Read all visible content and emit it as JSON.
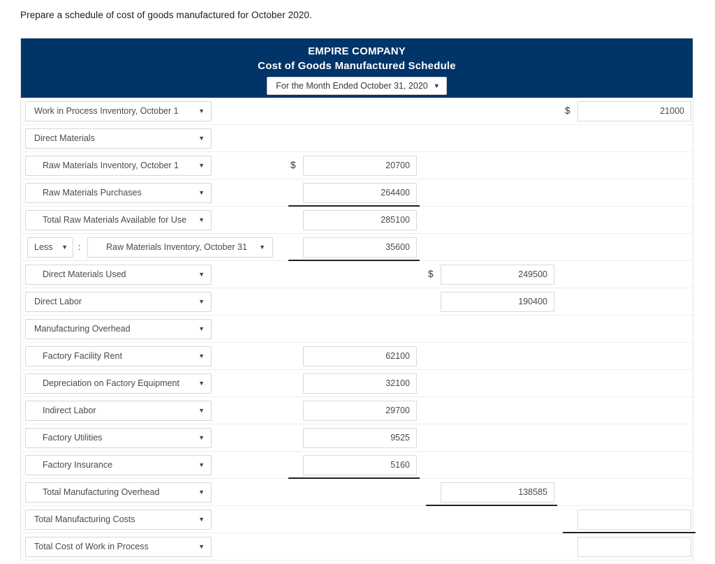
{
  "prompt": "Prepare a schedule of cost of goods manufactured for October 2020.",
  "header": {
    "company": "EMPIRE COMPANY",
    "title": "Cost of Goods Manufactured Schedule",
    "period_selected": "For the Month Ended October 31, 2020",
    "background_color": "#013468"
  },
  "columns": {
    "col1_label": "detail-amount-column",
    "col2_label": "subtotal-amount-column",
    "col3_label": "total-amount-column"
  },
  "caret_glyph": "▼",
  "colon": ":",
  "currency_symbol": "$",
  "rows": [
    {
      "label": "Work in Process Inventory, October 1",
      "indent": false,
      "col3_value": "21000",
      "col3_dollar": true
    },
    {
      "label": "Direct Materials",
      "indent": false
    },
    {
      "label": "Raw Materials Inventory, October 1",
      "indent": true,
      "col1_value": "20700",
      "col1_dollar": true
    },
    {
      "label": "Raw Materials Purchases",
      "indent": true,
      "col1_value": "264400",
      "rule_col1": true
    },
    {
      "label": "Total Raw Materials Available for Use",
      "indent": true,
      "col1_value": "285100"
    },
    {
      "prefix_label": "Less",
      "label": "Raw Materials Inventory, October 31",
      "compound": true,
      "col1_value": "35600",
      "rule_col1": true
    },
    {
      "label": "Direct Materials Used",
      "indent": true,
      "col2_value": "249500",
      "col2_dollar": true
    },
    {
      "label": "Direct Labor",
      "indent": false,
      "col2_value": "190400"
    },
    {
      "label": "Manufacturing Overhead",
      "indent": false
    },
    {
      "label": "Factory Facility Rent",
      "indent": true,
      "col1_value": "62100"
    },
    {
      "label": "Depreciation on Factory Equipment",
      "indent": true,
      "col1_value": "32100"
    },
    {
      "label": "Indirect Labor",
      "indent": true,
      "col1_value": "29700"
    },
    {
      "label": "Factory Utilities",
      "indent": true,
      "col1_value": "9525"
    },
    {
      "label": "Factory Insurance",
      "indent": true,
      "col1_value": "5160",
      "rule_col1": true
    },
    {
      "label": "Total Manufacturing Overhead",
      "indent": true,
      "col2_value": "138585",
      "rule_col2": true
    },
    {
      "label": "Total Manufacturing Costs",
      "indent": false,
      "col3_value": "",
      "rule_col3": true
    },
    {
      "label": "Total Cost of Work in Process",
      "indent": false,
      "col3_value": ""
    }
  ]
}
